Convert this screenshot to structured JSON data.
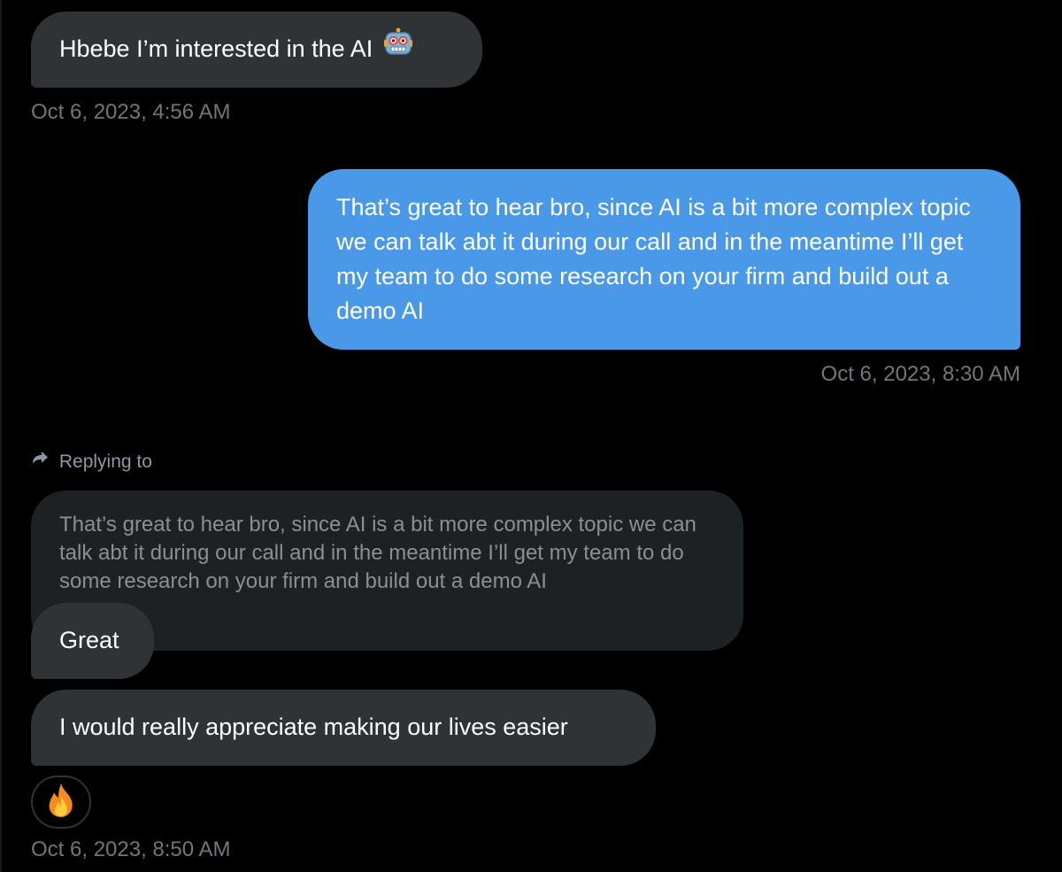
{
  "messages": [
    {
      "id": "msg1",
      "direction": "received",
      "text": "Hbebe I’m interested in the AI",
      "emoji": "robot-face",
      "timestamp": "Oct 6, 2023, 4:56 AM"
    },
    {
      "id": "msg2",
      "direction": "sent",
      "text": "That’s great to hear bro, since AI is a bit more complex topic we can talk abt it during our call and in the meantime I’ll get my team to do some research on your firm and build out a demo AI",
      "timestamp": "Oct 6, 2023, 8:30 AM"
    },
    {
      "id": "msg3",
      "direction": "received",
      "replying_label": "Replying to",
      "quoted_text": "That’s great to hear bro, since AI is a bit more complex topic we can talk abt it during our call and in the meantime I’ll get my team to do some research on your firm and build out a demo AI",
      "text": "Great"
    },
    {
      "id": "msg4",
      "direction": "received",
      "text": "I would really appreciate making our lives easier",
      "reaction": "fire",
      "timestamp": "Oct 6, 2023, 8:50 AM"
    }
  ],
  "colors": {
    "background": "#000000",
    "received_bubble": "#2f3336",
    "sent_bubble": "#4a99e9",
    "quoted_bubble": "#1e2124",
    "timestamp_text": "#71767b"
  }
}
